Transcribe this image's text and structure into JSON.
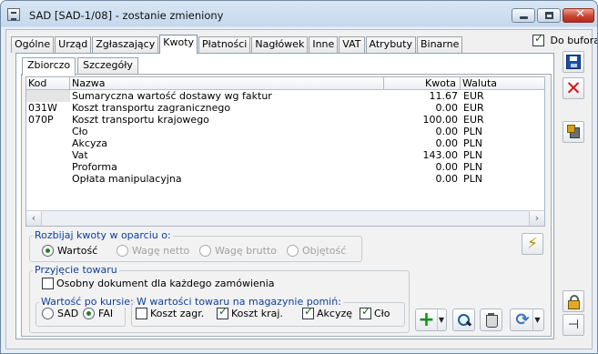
{
  "window": {
    "title": "SAD [SAD-1/08]  - zostanie zmieniony",
    "controls": {
      "minimize": "",
      "maximize": "",
      "close": "✕"
    }
  },
  "tabs": [
    "Ogólne",
    "Urząd",
    "Zgłaszający",
    "Kwoty",
    "Płatności",
    "Nagłówek",
    "Inne",
    "VAT",
    "Atrybuty",
    "Binarne"
  ],
  "active_tab": "Kwoty",
  "checkbox_do_bufora": {
    "label": "Do bufora",
    "checked": true
  },
  "subtabs": [
    "Zbiorczo",
    "Szczegóły"
  ],
  "active_subtab": "Zbiorczo",
  "table": {
    "headers": {
      "kod": "Kod",
      "nazwa": "Nazwa",
      "kwota": "Kwota",
      "waluta": "Waluta"
    },
    "rows": [
      {
        "kod": "",
        "nazwa": "Sumaryczna wartość dostawy wg faktur",
        "kwota": "11.67",
        "waluta": "EUR"
      },
      {
        "kod": "031W",
        "nazwa": "Koszt transportu zagranicznego",
        "kwota": "0.00",
        "waluta": "EUR"
      },
      {
        "kod": "070P",
        "nazwa": "Koszt transportu krajowego",
        "kwota": "100.00",
        "waluta": "EUR"
      },
      {
        "kod": "",
        "nazwa": "Cło",
        "kwota": "0.00",
        "waluta": "PLN"
      },
      {
        "kod": "",
        "nazwa": "Akcyza",
        "kwota": "0.00",
        "waluta": "PLN"
      },
      {
        "kod": "",
        "nazwa": "Vat",
        "kwota": "143.00",
        "waluta": "PLN"
      },
      {
        "kod": "",
        "nazwa": "Proforma",
        "kwota": "0.00",
        "waluta": "PLN"
      },
      {
        "kod": "",
        "nazwa": "Opłata manipulacyjna",
        "kwota": "0.00",
        "waluta": "PLN"
      }
    ],
    "scroll": {
      "left": "‹",
      "right": "›"
    }
  },
  "rozbijaj": {
    "title": "Rozbijaj kwoty w oparciu o:",
    "options": [
      "Wartość",
      "Wagę netto",
      "Wagę brutto",
      "Objętość"
    ],
    "selected": "Wartość"
  },
  "przyjecie": {
    "title": "Przyjęcie towaru",
    "checkbox_label": "Osobny dokument dla każdego zamówienia",
    "checked": false
  },
  "wartosc_po_kursie": {
    "title": "Wartość po kursie:",
    "options": [
      "SAD",
      "FAI"
    ],
    "selected": "FAI"
  },
  "pomin": {
    "title": "W wartości towaru na magazynie pomiń:",
    "options": [
      {
        "label": "Koszt zagr.",
        "checked": false
      },
      {
        "label": "Koszt kraj.",
        "checked": true
      },
      {
        "label": "Akcyzę",
        "checked": true
      },
      {
        "label": "Cło",
        "checked": true
      }
    ]
  },
  "icons": {
    "save": "save-icon",
    "cancel": "cancel-icon",
    "package": "package-icon",
    "calculate": "lightning-icon",
    "lock": "lock-icon",
    "pin": "pin-icon",
    "add": "plus-icon",
    "search": "search-icon",
    "delete": "trash-icon",
    "options": "settings-icon"
  }
}
